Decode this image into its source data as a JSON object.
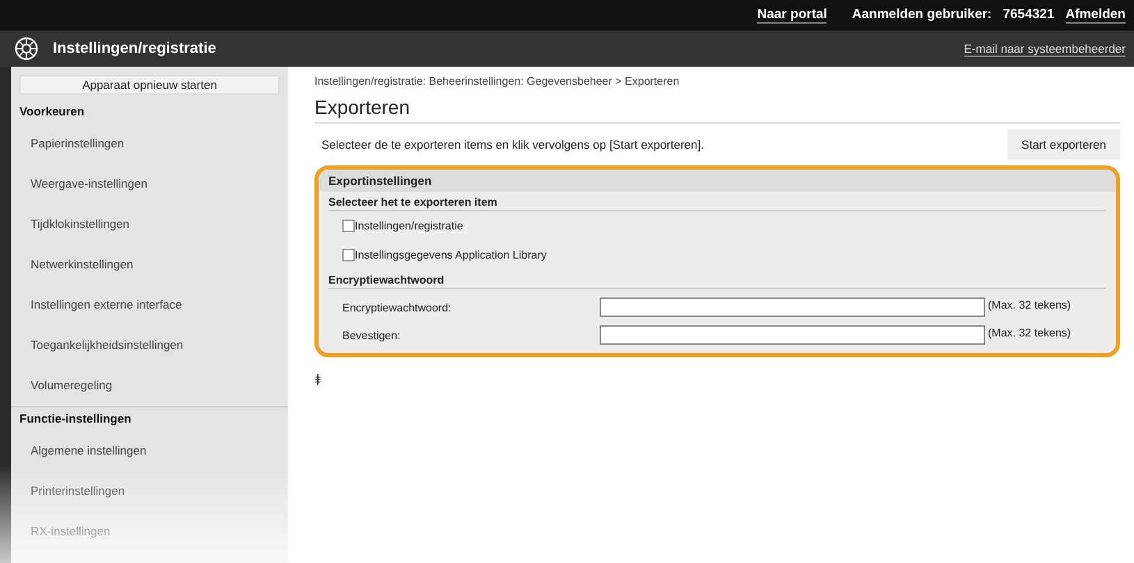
{
  "top_bar": {
    "links": [
      {
        "kind": "link",
        "text": "Naar portal"
      },
      {
        "kind": "label",
        "text": "Aanmelden gebruiker:"
      },
      {
        "kind": "label",
        "text": "7654321"
      },
      {
        "kind": "link",
        "text": "Afmelden"
      }
    ]
  },
  "header": {
    "title": "Instellingen/registratie",
    "mail_link": "E-mail naar systeembeheerder"
  },
  "sidebar": {
    "items": [
      {
        "kind": "button",
        "text": "Apparaat opnieuw starten"
      },
      {
        "kind": "header",
        "text": "Voorkeuren"
      },
      {
        "kind": "item",
        "text": "Papierinstellingen"
      },
      {
        "kind": "item",
        "text": "Weergave-instellingen"
      },
      {
        "kind": "item",
        "text": "Tijdklokinstellingen"
      },
      {
        "kind": "item",
        "text": "Netwerkinstellingen"
      },
      {
        "kind": "item",
        "text": "Instellingen externe interface"
      },
      {
        "kind": "item",
        "text": "Toegankelijkheidsinstellingen"
      },
      {
        "kind": "item",
        "text": "Volumeregeling"
      },
      {
        "kind": "header",
        "text": "Functie-instellingen"
      },
      {
        "kind": "item",
        "text": "Algemene instellingen"
      },
      {
        "kind": "item",
        "text": "Printerinstellingen"
      },
      {
        "kind": "item",
        "text": "RX-instellingen"
      }
    ]
  },
  "breadcrumb": "Instellingen/registratie: Beheerinstellingen: Gegevensbeheer > Exporteren",
  "page_title": "Exporteren",
  "instruction": "Selecteer de te exporteren items en klik vervolgens op [Start exporteren].",
  "start_button": "Start exporteren",
  "panel": {
    "title": "Exportinstellingen",
    "sections": [
      {
        "heading": "Selecteer het te exporteren item",
        "rows": [
          {
            "kind": "checkbox",
            "label": "Instellingen/registratie",
            "checked": false
          },
          {
            "kind": "checkbox",
            "label": "Instellingsgegevens Application Library",
            "checked": false
          }
        ]
      },
      {
        "heading": "Encryptiewachtwoord",
        "rows": [
          {
            "kind": "password",
            "label": "Encryptiewachtwoord:",
            "note": "(Max. 32 tekens)"
          },
          {
            "kind": "password",
            "label": "Bevestigen:",
            "note": "(Max. 32 tekens)"
          }
        ]
      }
    ]
  },
  "to_top": "⯒"
}
